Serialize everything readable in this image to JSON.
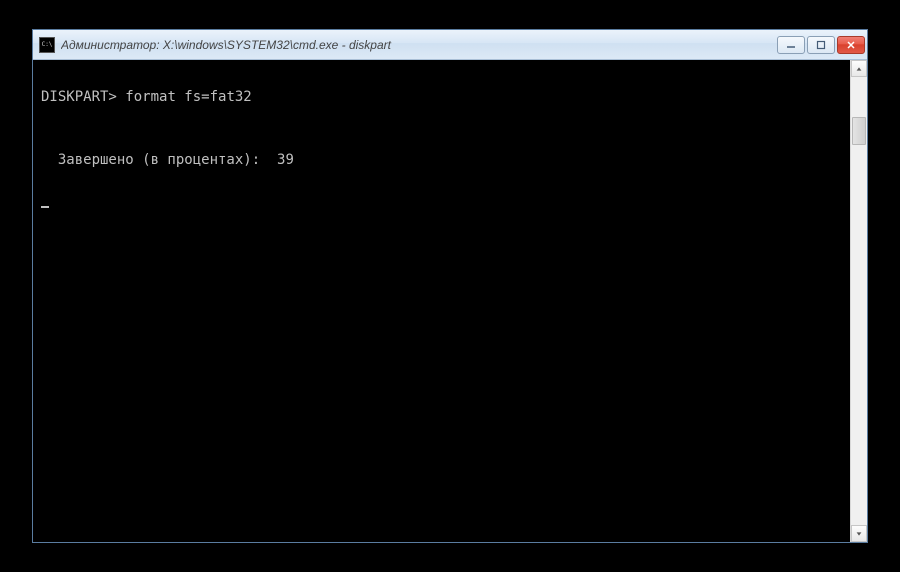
{
  "window": {
    "title": "Администратор: X:\\windows\\SYSTEM32\\cmd.exe - diskpart"
  },
  "console": {
    "prompt": "DISKPART>",
    "command": "format fs=fat32",
    "progress_label": "Завершено (в процентах):",
    "progress_value": "39"
  }
}
